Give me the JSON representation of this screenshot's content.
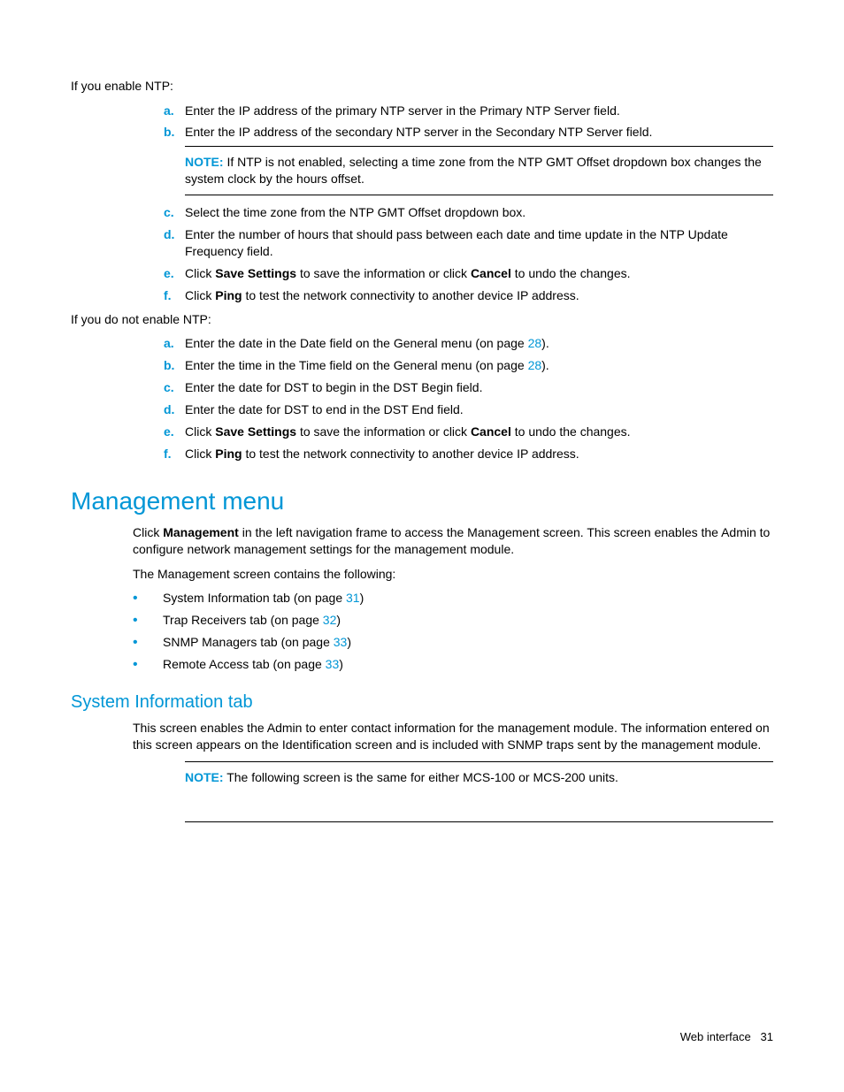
{
  "intro1": "If you enable NTP:",
  "list1": {
    "a": "Enter the IP address of the primary NTP server in the Primary NTP Server field.",
    "b": "Enter the IP address of the secondary NTP server in the Secondary NTP Server field.",
    "c": "Select the time zone from the NTP GMT Offset dropdown box.",
    "d": "Enter the number of hours that should pass between each date and time update in the NTP Update Frequency field.",
    "e_pre": "Click ",
    "e_b1": "Save Settings",
    "e_mid": " to save the information or click ",
    "e_b2": "Cancel",
    "e_post": " to undo the changes.",
    "f_pre": "Click ",
    "f_b1": "Ping",
    "f_post": " to test the network connectivity to another device IP address."
  },
  "note1": {
    "label": "NOTE:",
    "text": "  If NTP is not enabled, selecting a time zone from the NTP GMT Offset dropdown box changes the system clock by the hours offset."
  },
  "intro2": "If you do not enable NTP:",
  "list2": {
    "a_pre": "Enter the date in the Date field on the General menu (on page ",
    "a_link": "28",
    "a_post": ").",
    "b_pre": "Enter the time in the Time field on the General menu (on page ",
    "b_link": "28",
    "b_post": ").",
    "c": "Enter the date for DST to begin in the DST Begin field.",
    "d": "Enter the date for DST to end in the DST End field.",
    "e_pre": "Click ",
    "e_b1": "Save Settings",
    "e_mid": " to save the information or click ",
    "e_b2": "Cancel",
    "e_post": " to undo the changes.",
    "f_pre": "Click ",
    "f_b1": "Ping",
    "f_post": " to test the network connectivity to another device IP address."
  },
  "h1": "Management menu",
  "mgmt_p1_pre": "Click ",
  "mgmt_p1_b": "Management",
  "mgmt_p1_post": " in the left navigation frame to access the Management screen. This screen enables the Admin to configure network management settings for the management module.",
  "mgmt_p2": "The Management screen contains the following:",
  "bullets": {
    "b1_pre": "System Information tab (on page ",
    "b1_link": "31",
    "b1_post": ")",
    "b2_pre": "Trap Receivers tab (on page ",
    "b2_link": "32",
    "b2_post": ")",
    "b3_pre": "SNMP Managers tab (on page ",
    "b3_link": "33",
    "b3_post": ")",
    "b4_pre": "Remote Access tab (on page ",
    "b4_link": "33",
    "b4_post": ")"
  },
  "h2": "System Information tab",
  "sys_p1": "This screen enables the Admin to enter contact information for the management module. The information entered on this screen appears on the Identification screen and is included with SNMP traps sent by the management module.",
  "note2": {
    "label": "NOTE:",
    "text": "  The following screen is the same for either MCS-100 or MCS-200 units."
  },
  "footer_label": "Web interface",
  "footer_page": "31",
  "markers": {
    "a": "a.",
    "b": "b.",
    "c": "c.",
    "d": "d.",
    "e": "e.",
    "f": "f.",
    "dot": "•"
  }
}
